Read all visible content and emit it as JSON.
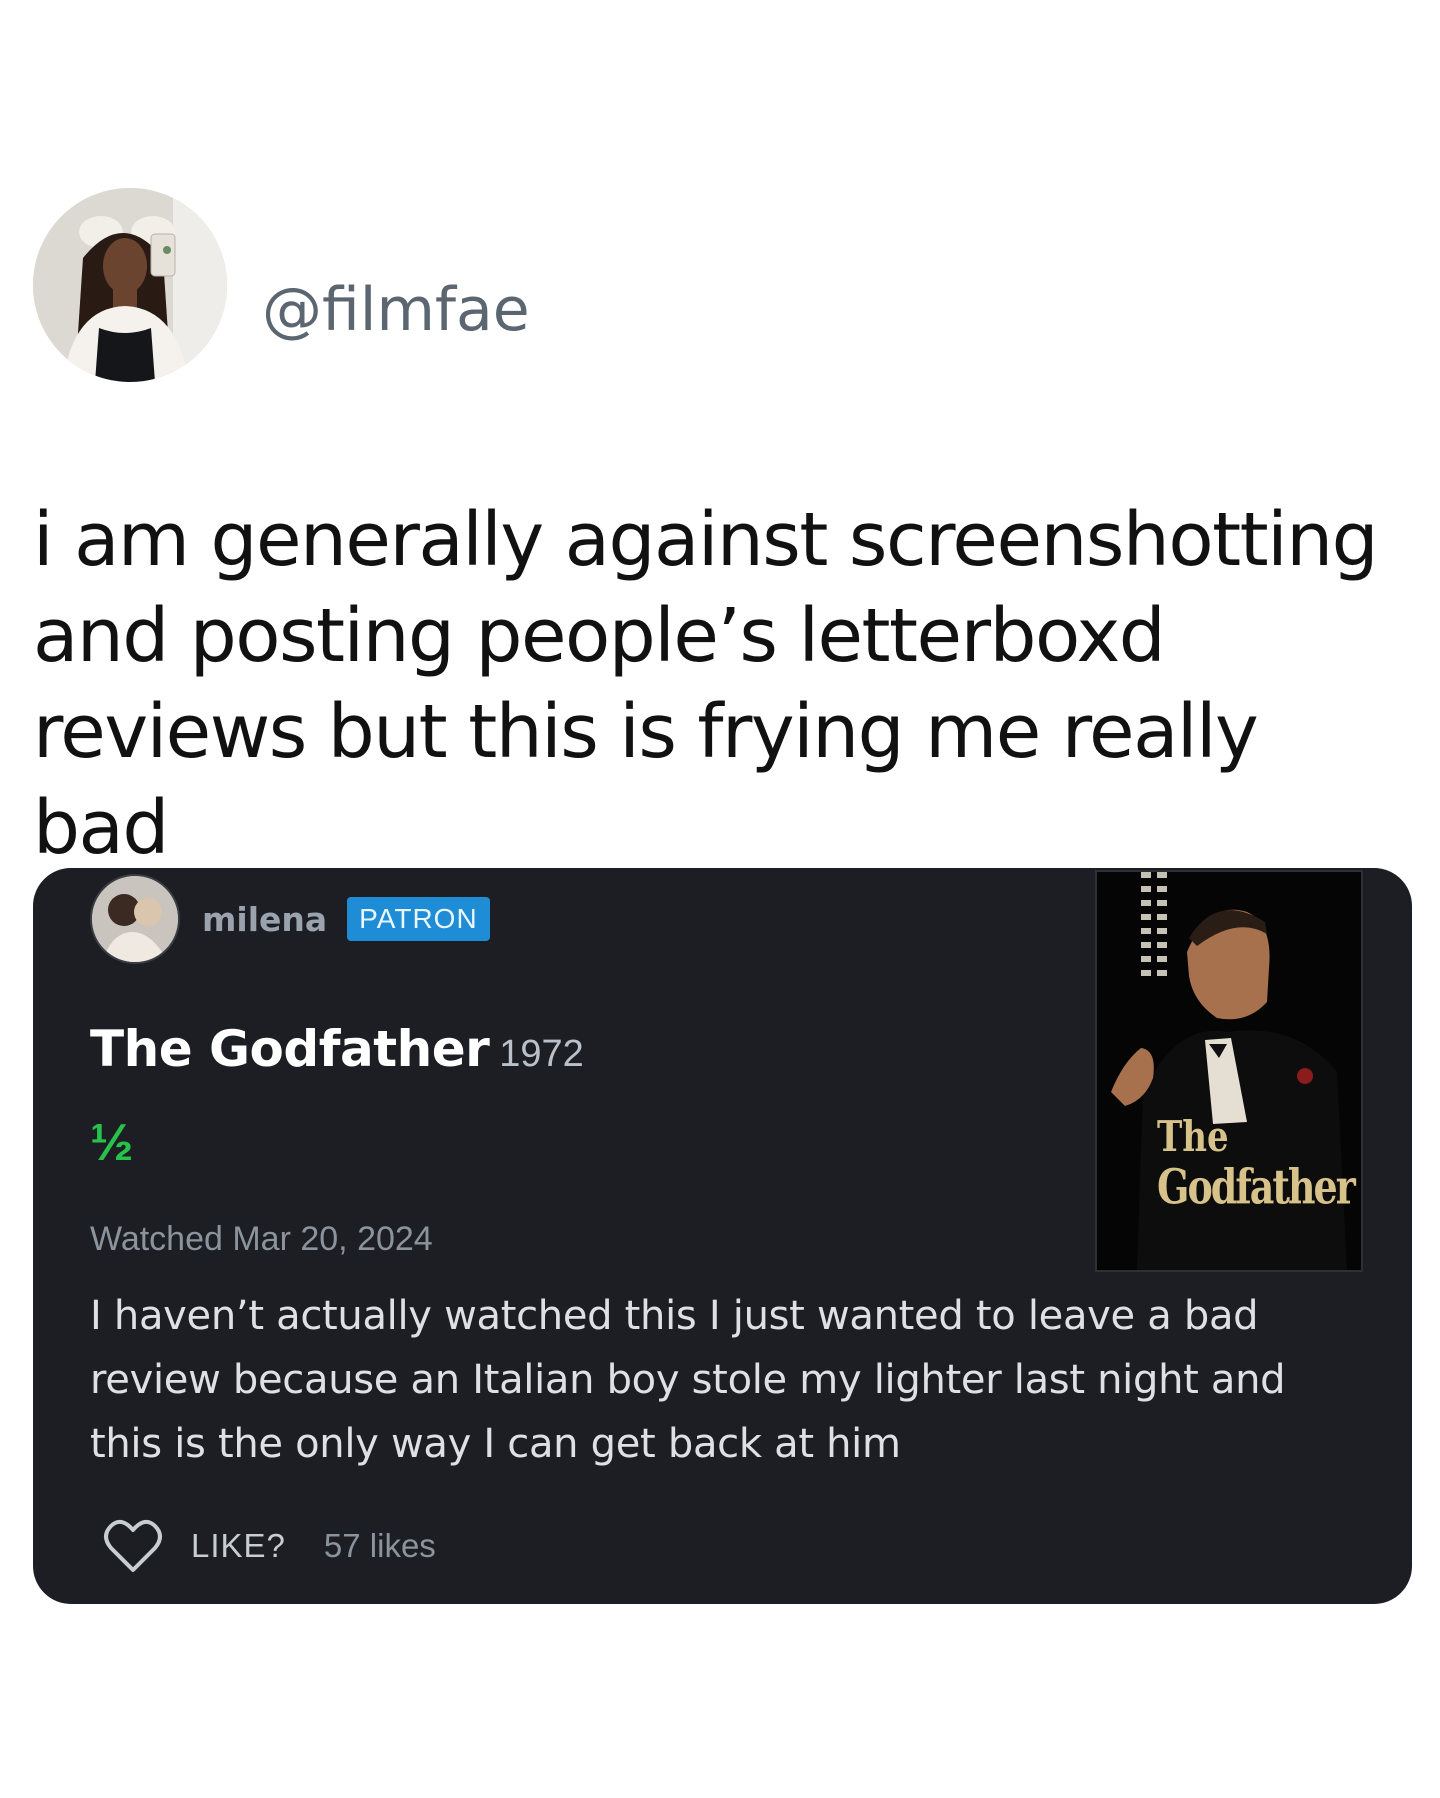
{
  "tweet": {
    "handle": "@filmfae",
    "text": "i am generally against screenshotting and posting people’s letterboxd reviews but this is frying me really bad"
  },
  "review_card": {
    "username": "milena",
    "badge": "PATRON",
    "film_title": "The Godfather",
    "film_year": "1972",
    "rating": "½",
    "watched": "Watched Mar 20, 2024",
    "review_text": "I haven’t actually watched this I just wanted to leave a bad review because an Italian boy stole my lighter last night and this is the only way I can get back at him",
    "like_label": "LIKE?",
    "likes": "57 likes",
    "poster": {
      "title_line1": "The",
      "title_line2": "Godfather"
    }
  },
  "colors": {
    "card_bg": "#1c1e23",
    "patron_badge": "#1f8dd6",
    "rating_green": "#27c24a",
    "poster_gold": "#d7c28a"
  },
  "icons": {
    "like": "heart-icon"
  }
}
